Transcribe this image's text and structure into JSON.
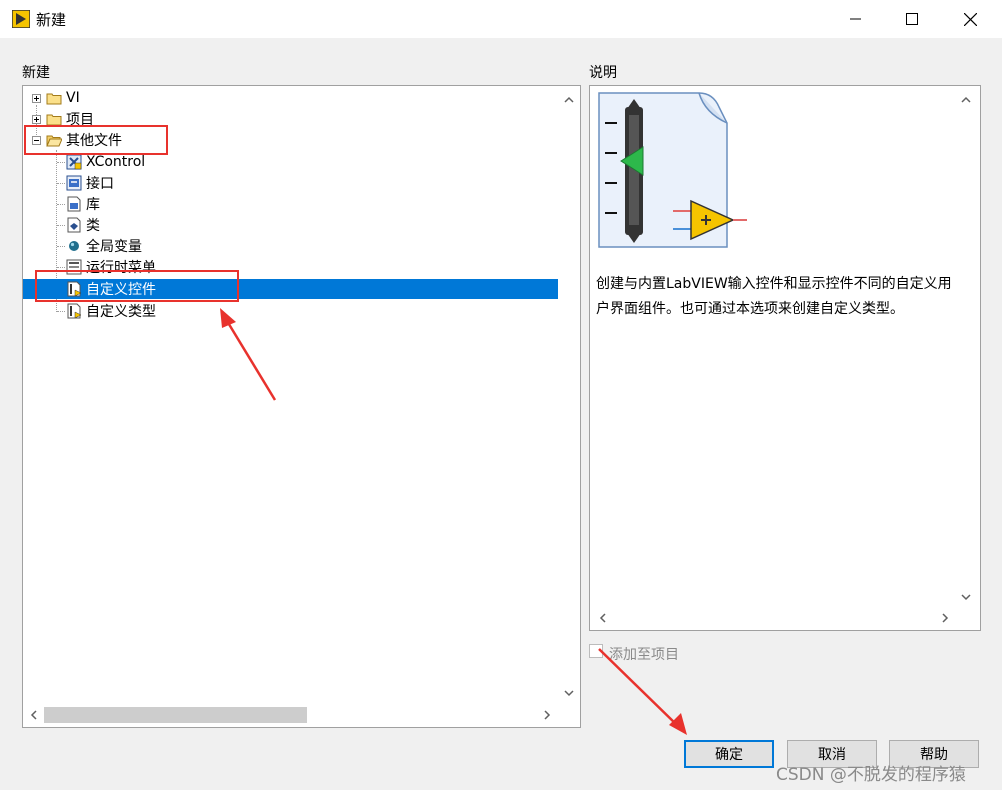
{
  "window": {
    "title": "新建"
  },
  "tree_panel": {
    "label": "新建",
    "items": [
      {
        "label": "VI",
        "icon": "folder-icon",
        "expander": "plus"
      },
      {
        "label": "项目",
        "icon": "folder-icon",
        "expander": "plus"
      },
      {
        "label": "其他文件",
        "icon": "folder-open-icon",
        "expander": "minus"
      },
      {
        "label": "XControl",
        "icon": "xcontrol-icon"
      },
      {
        "label": "接口",
        "icon": "interface-icon"
      },
      {
        "label": "库",
        "icon": "library-icon"
      },
      {
        "label": "类",
        "icon": "class-icon"
      },
      {
        "label": "全局变量",
        "icon": "global-variable-icon"
      },
      {
        "label": "运行时菜单",
        "icon": "runtime-menu-icon"
      },
      {
        "label": "自定义控件",
        "icon": "custom-control-icon",
        "selected": true
      },
      {
        "label": "自定义类型",
        "icon": "custom-type-icon"
      }
    ]
  },
  "description_panel": {
    "label": "说明",
    "text": "创建与内置LabVIEW输入控件和显示控件不同的自定义用户界面组件。也可通过本选项来创建自定义类型。"
  },
  "add_to_project": {
    "label": "添加至项目",
    "checked": false,
    "enabled": false
  },
  "buttons": {
    "ok": "确定",
    "cancel": "取消",
    "help": "帮助"
  },
  "watermark": "CSDN @不脱发的程序猿",
  "colors": {
    "selection": "#0078d7",
    "annotation": "#e8322d"
  }
}
